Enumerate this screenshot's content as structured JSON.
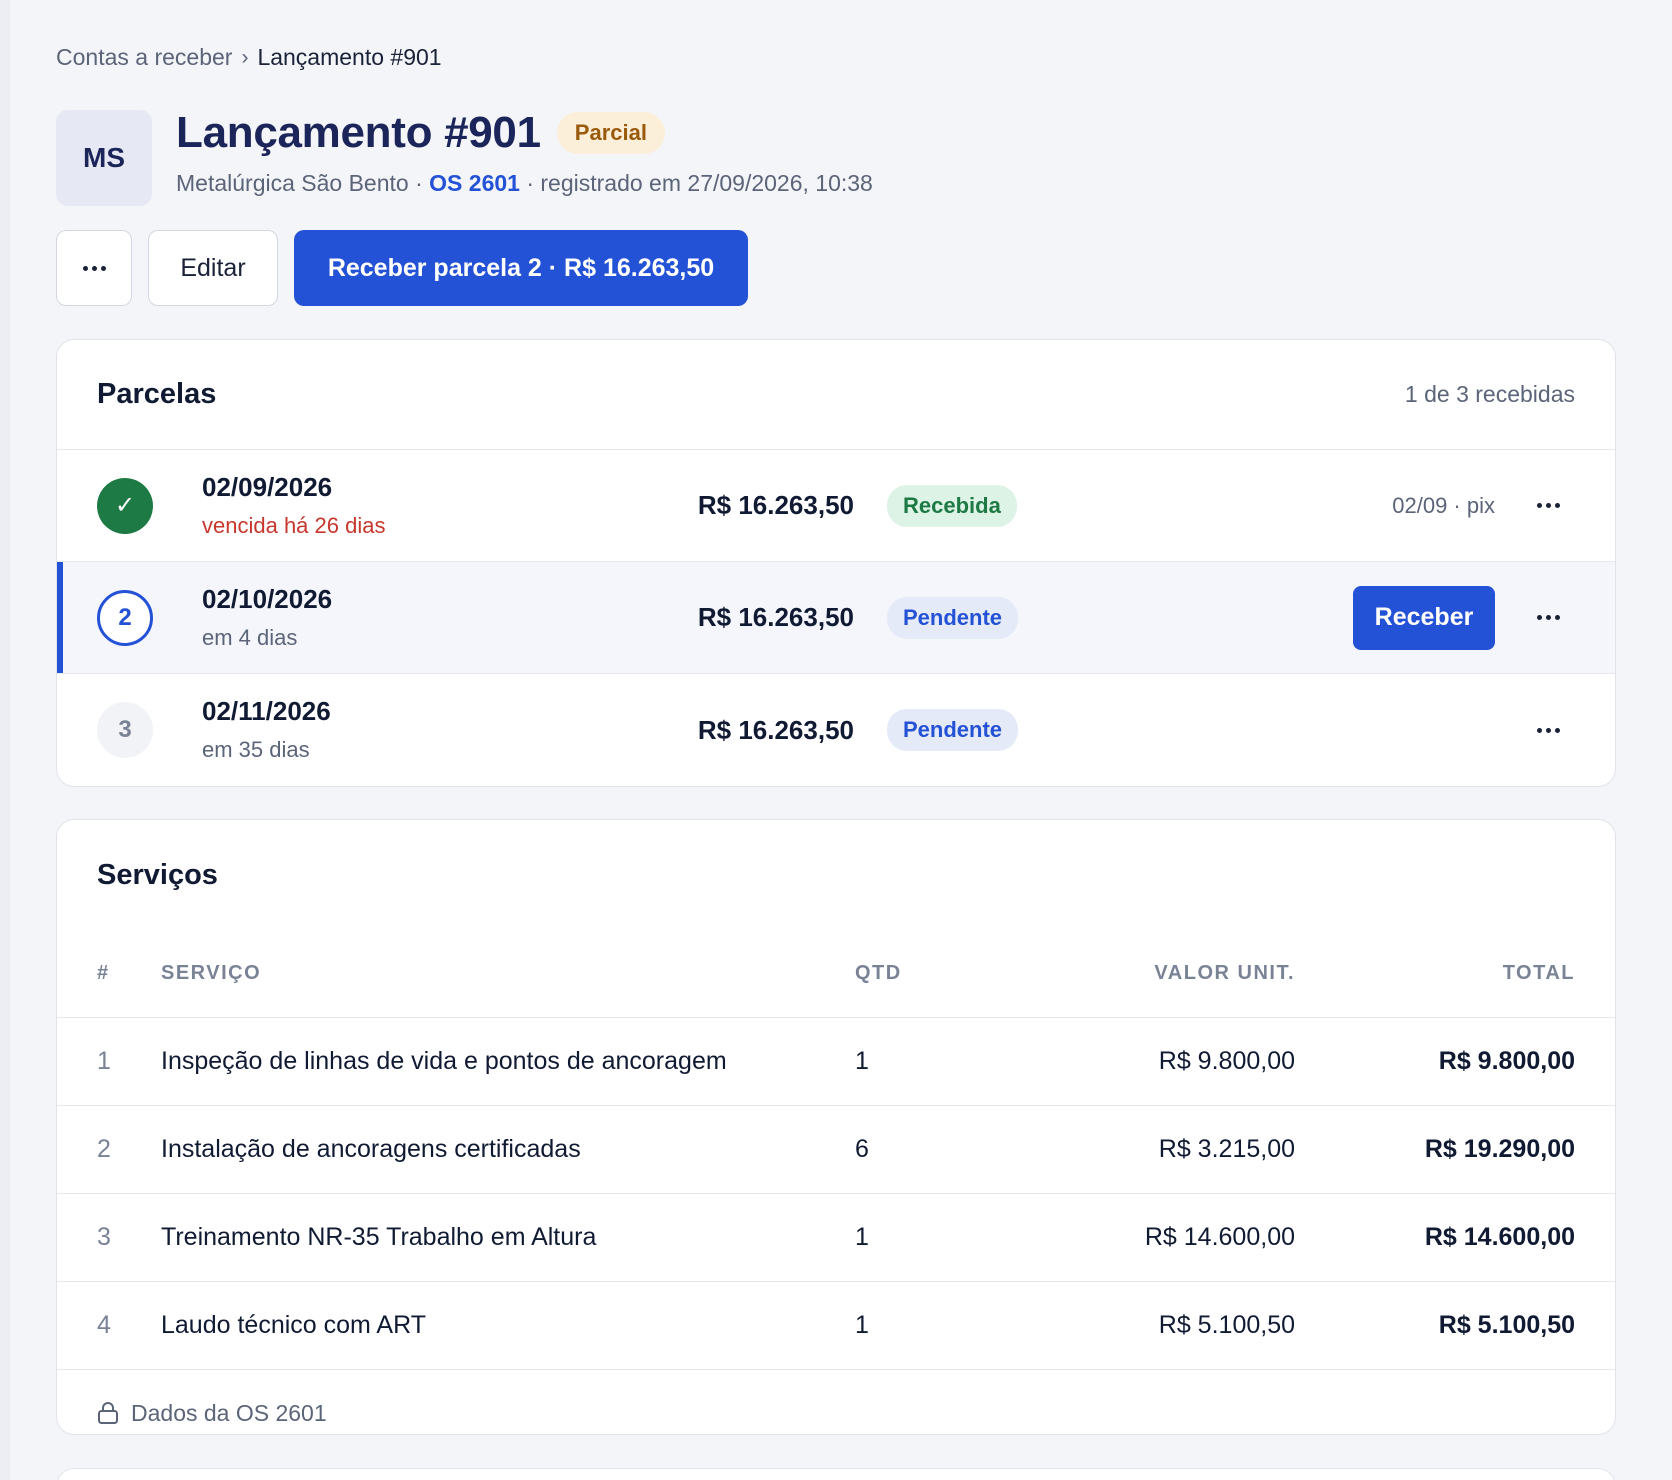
{
  "breadcrumb": {
    "parent": "Contas a receber",
    "separator": "›",
    "current": "Lançamento #901"
  },
  "header": {
    "avatar_initials": "MS",
    "title": "Lançamento #901",
    "status": "Parcial",
    "client": "Metalúrgica São Bento",
    "dot1": " · ",
    "os_link": "OS 2601",
    "registered": " · registrado em 27/09/2026, 10:38"
  },
  "actions": {
    "edit_label": "Editar",
    "primary_label": "Receber parcela 2 · R$ 16.263,50"
  },
  "parcelas": {
    "title": "Parcelas",
    "summary": "1 de 3 recebidas",
    "items": [
      {
        "marker": "✓",
        "date": "02/09/2026",
        "due": "vencida há 26 dias",
        "amount": "R$ 16.263,50",
        "status": "Recebida",
        "meta": "02/09 · pix"
      },
      {
        "marker": "2",
        "date": "02/10/2026",
        "due": "em 4 dias",
        "amount": "R$ 16.263,50",
        "status": "Pendente",
        "action": "Receber"
      },
      {
        "marker": "3",
        "date": "02/11/2026",
        "due": "em 35 dias",
        "amount": "R$ 16.263,50",
        "status": "Pendente"
      }
    ]
  },
  "servicos": {
    "title": "Serviços",
    "columns": {
      "num": "#",
      "service": "SERVIÇO",
      "qty": "QTD",
      "unit": "VALOR UNIT.",
      "total": "TOTAL"
    },
    "rows": [
      {
        "num": "1",
        "service": "Inspeção de linhas de vida e pontos de ancoragem",
        "qty": "1",
        "unit": "R$ 9.800,00",
        "total": "R$ 9.800,00"
      },
      {
        "num": "2",
        "service": "Instalação de ancoragens certificadas",
        "qty": "6",
        "unit": "R$ 3.215,00",
        "total": "R$ 19.290,00"
      },
      {
        "num": "3",
        "service": "Treinamento NR-35 Trabalho em Altura",
        "qty": "1",
        "unit": "R$ 14.600,00",
        "total": "R$ 14.600,00"
      },
      {
        "num": "4",
        "service": "Laudo técnico com ART",
        "qty": "1",
        "unit": "R$ 5.100,50",
        "total": "R$ 5.100,50"
      }
    ],
    "footer": "Dados da OS 2601"
  },
  "icons": {
    "more": "more-horizontal-icon",
    "check": "check-icon",
    "lock": "lock-icon"
  },
  "colors": {
    "primary": "#2452d6",
    "success": "#1e7a45",
    "danger": "#c8372d",
    "warning_bg": "#fcefd9",
    "warning_fg": "#9a5a0c"
  }
}
